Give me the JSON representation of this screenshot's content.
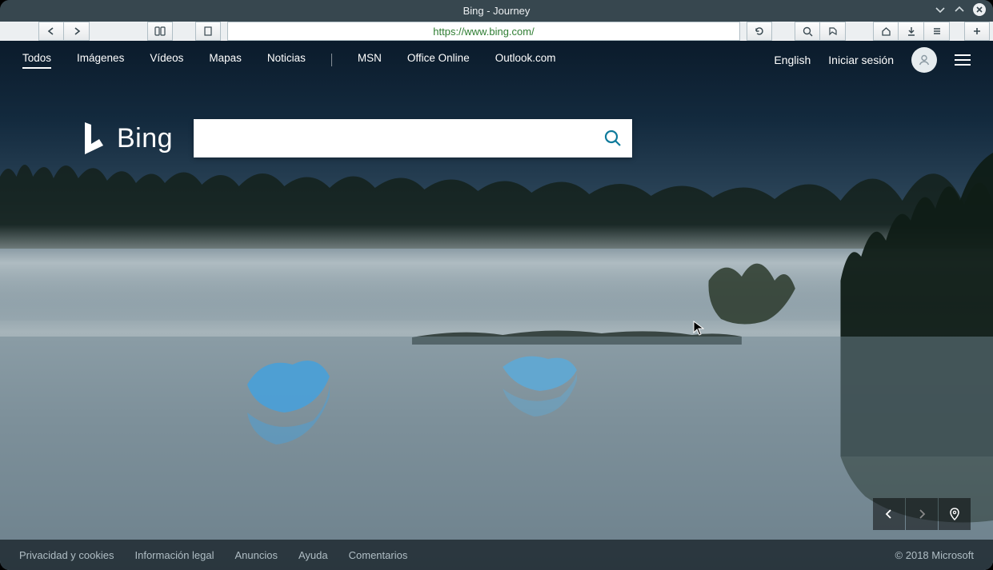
{
  "window": {
    "title": "Bing - Journey"
  },
  "browser": {
    "url": "https://www.bing.com/"
  },
  "nav": {
    "links": [
      {
        "label": "Todos"
      },
      {
        "label": "Imágenes"
      },
      {
        "label": "Vídeos"
      },
      {
        "label": "Mapas"
      },
      {
        "label": "Noticias"
      },
      {
        "label": "MSN"
      },
      {
        "label": "Office Online"
      },
      {
        "label": "Outlook.com"
      }
    ],
    "right": {
      "language": "English",
      "signin": "Iniciar sesión"
    }
  },
  "logo": {
    "text": "Bing"
  },
  "search": {
    "value": "",
    "placeholder": ""
  },
  "footer": {
    "links": [
      {
        "label": "Privacidad y cookies"
      },
      {
        "label": "Información legal"
      },
      {
        "label": "Anuncios"
      },
      {
        "label": "Ayuda"
      },
      {
        "label": "Comentarios"
      }
    ],
    "copyright": "© 2018 Microsoft"
  }
}
